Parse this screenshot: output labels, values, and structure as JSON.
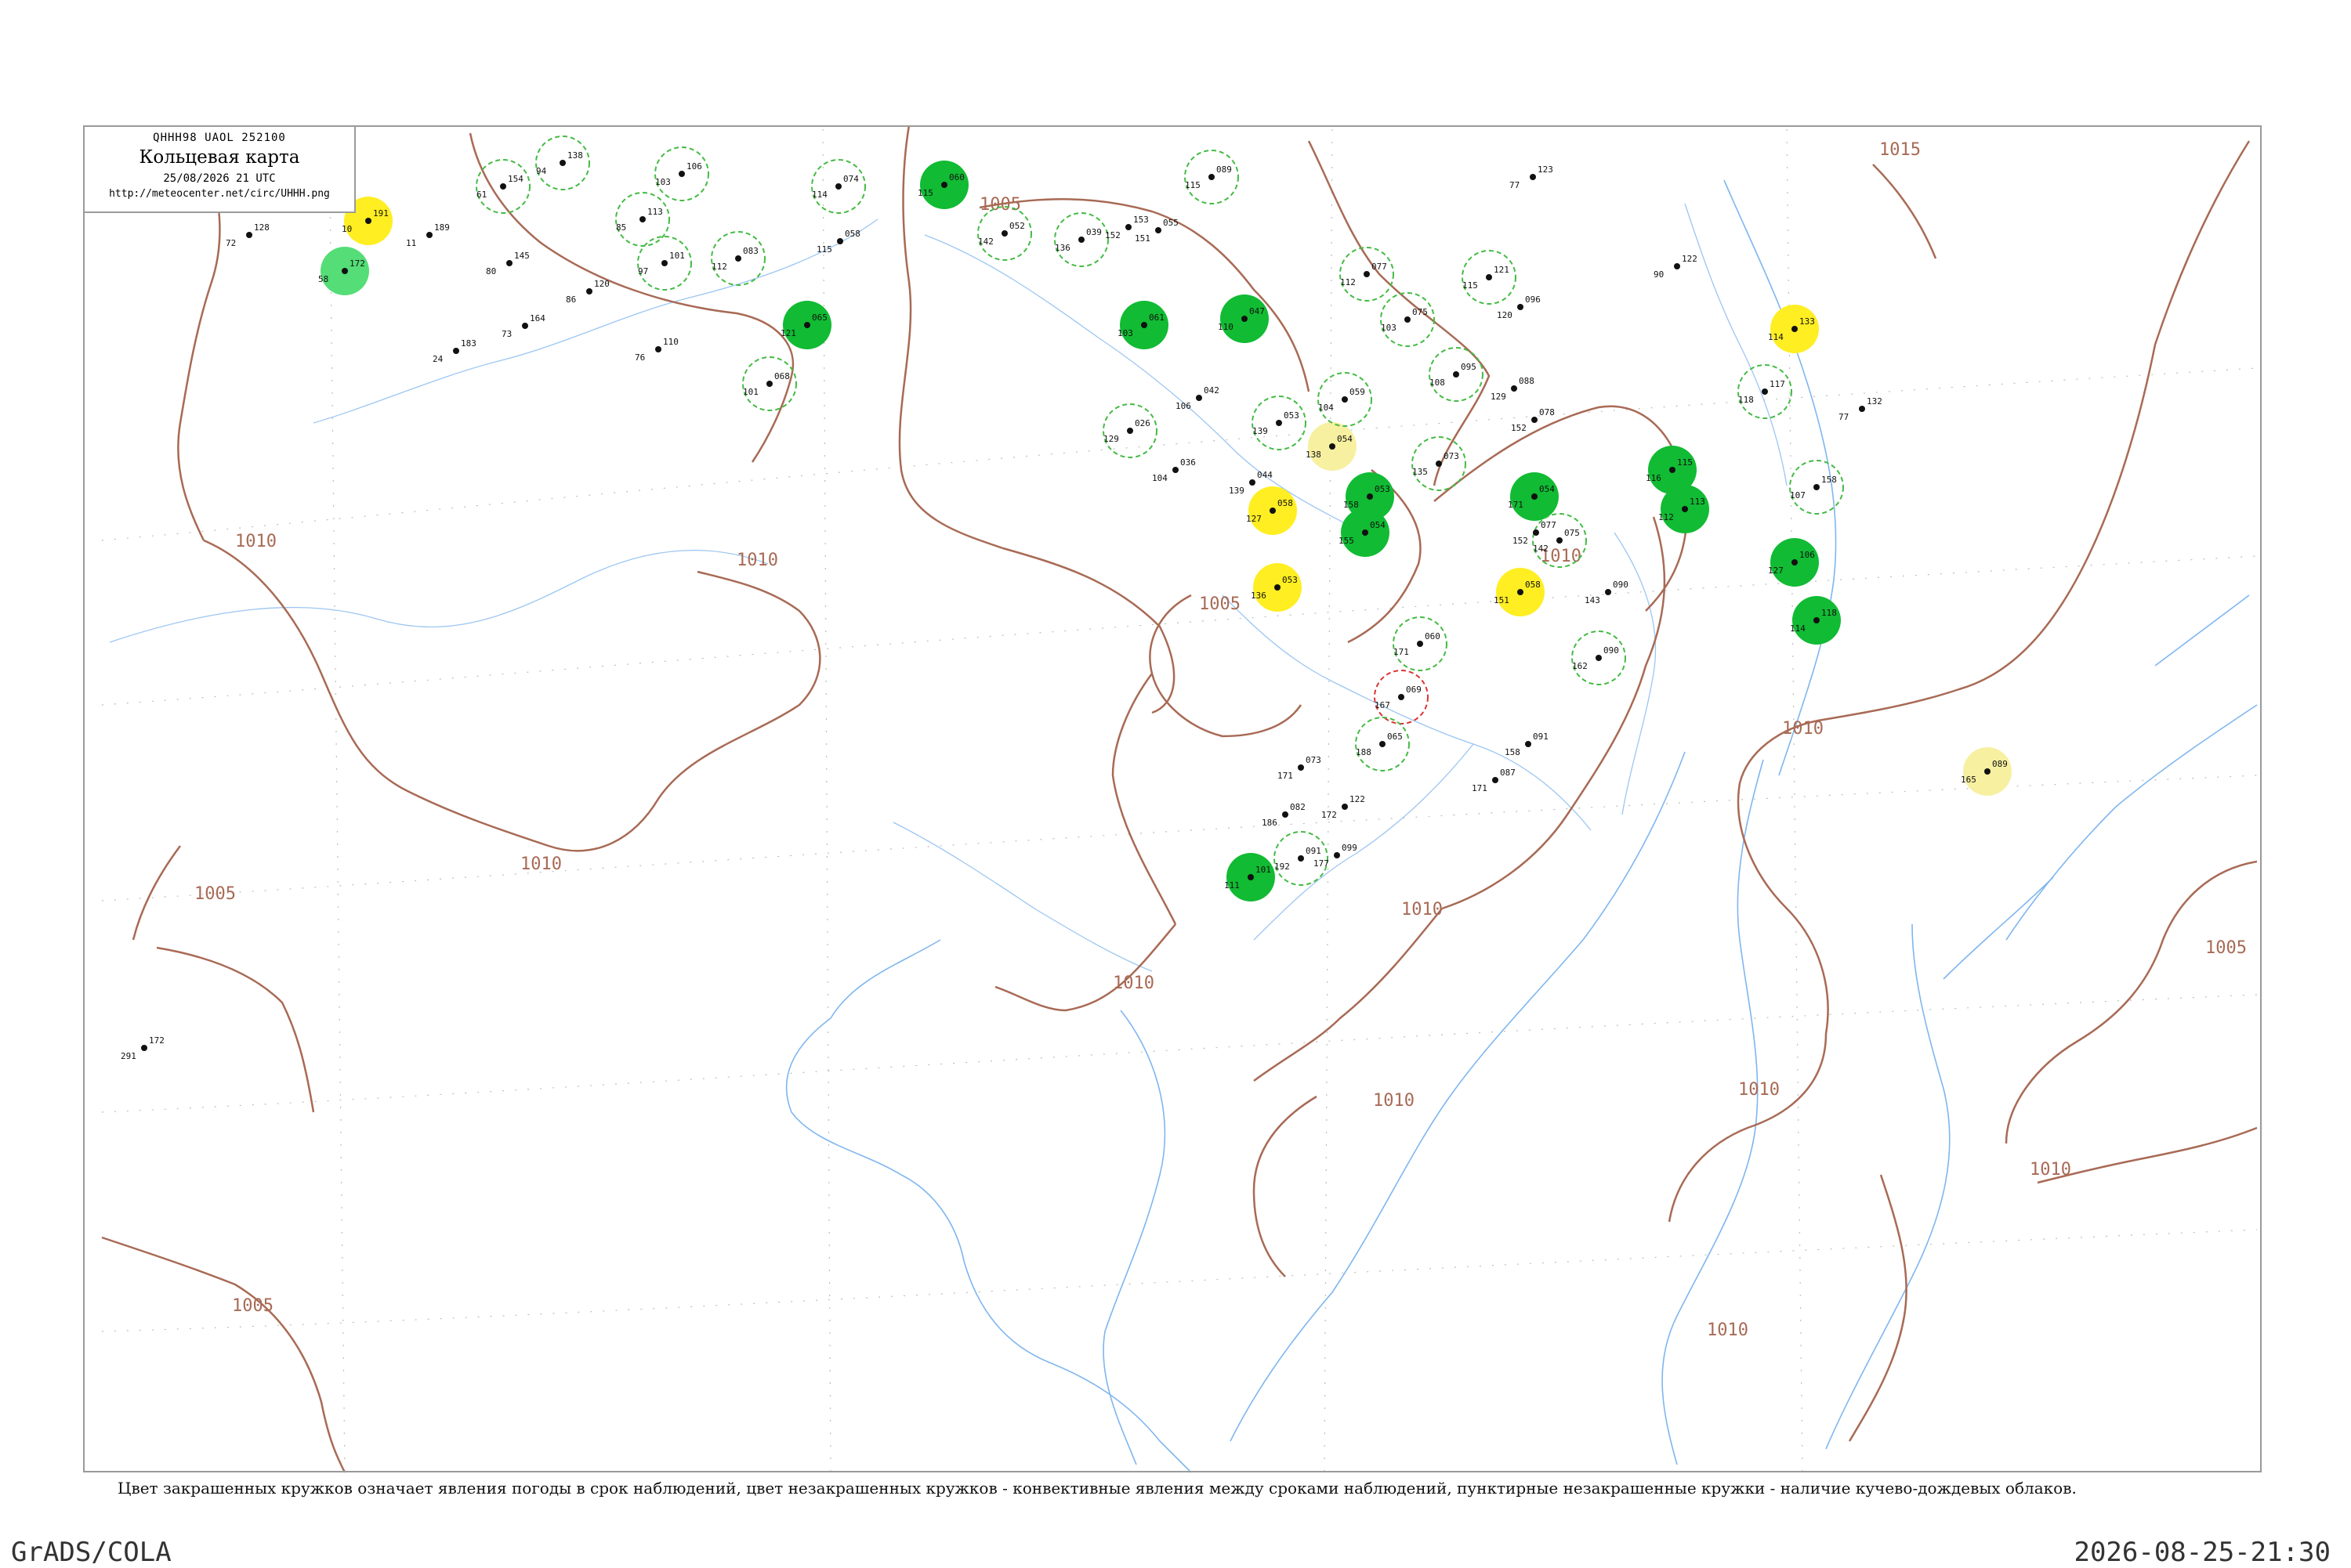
{
  "header": {
    "bulletin_code": "QHHH98  UAOL  252100",
    "title": "Кольцевая карта",
    "date": "25/08/2026 21 UTC",
    "url": "http://meteocenter.net/circ/UHHH.png"
  },
  "footer": {
    "legend_note": "Цвет закрашенных кружков означает явления погоды в срок наблюдений, цвет незакрашенных кружков - конвективные явления между сроками наблюдений, пунктирные незакрашенные кружки - наличие кучево-дождевых облаков.",
    "software": "GrADS/COLA",
    "timestamp": "2026-08-25-21:30"
  },
  "isobar_labels": [
    "1015",
    "1005",
    "1010",
    "1010",
    "1005",
    "1010",
    "1010",
    "1005",
    "1010",
    "1010",
    "1010",
    "1005",
    "1010",
    "1010",
    "1010",
    "1010",
    "1005"
  ],
  "colors": {
    "isobar": "#a86a55",
    "coast": "#7fb6ef",
    "rain_fill": "#11bb33",
    "fog_fill": "#ffee22",
    "pale_yellow_fill": "#f7f0a0",
    "shower_fill": "#55dd77",
    "cb_ring": "#44bb44",
    "thunder_ring": "#dd3333"
  },
  "stations": {
    "filled": [
      {
        "fill": "#ffee22",
        "top": "191",
        "left": "10"
      },
      {
        "fill": "#55dd77",
        "top": "172",
        "left": "58"
      },
      {
        "fill": "#11bb33",
        "top": "065",
        "left": "121"
      },
      {
        "fill": "#11bb33",
        "top": "060",
        "left": "115"
      },
      {
        "fill": "#11bb33",
        "top": "061",
        "left": "103"
      },
      {
        "fill": "#11bb33",
        "top": "047",
        "left": "110"
      },
      {
        "fill": "#f7f0a0",
        "top": "054",
        "left": "138"
      },
      {
        "fill": "#ffee22",
        "top": "058",
        "left": "127"
      },
      {
        "fill": "#11bb33",
        "top": "053",
        "left": "158"
      },
      {
        "fill": "#11bb33",
        "top": "054",
        "left": "155"
      },
      {
        "fill": "#ffee22",
        "top": "053",
        "left": "136"
      },
      {
        "fill": "#11bb33",
        "top": "054",
        "left": "171"
      },
      {
        "fill": "#ffee22",
        "top": "058",
        "left": "151"
      },
      {
        "fill": "#11bb33",
        "top": "115",
        "left": "116"
      },
      {
        "fill": "#11bb33",
        "top": "113",
        "left": "112"
      },
      {
        "fill": "#ffee22",
        "top": "133",
        "left": "114"
      },
      {
        "fill": "#11bb33",
        "top": "106",
        "left": "127"
      },
      {
        "fill": "#11bb33",
        "top": "118",
        "left": "114"
      },
      {
        "fill": "#11bb33",
        "top": "101",
        "left": "111"
      },
      {
        "fill": "#f7f0a0",
        "top": "089",
        "left": "165"
      }
    ],
    "rings": [
      {
        "ring": "#44bb44",
        "top": "154",
        "left": "61"
      },
      {
        "ring": "#44bb44",
        "top": "138",
        "left": "94"
      },
      {
        "ring": "#44bb44",
        "top": "113",
        "left": "85"
      },
      {
        "ring": "#44bb44",
        "top": "106",
        "left": "103"
      },
      {
        "ring": "#44bb44",
        "top": "101",
        "left": "97"
      },
      {
        "ring": "#44bb44",
        "top": "083",
        "left": "112"
      },
      {
        "ring": "#44bb44",
        "top": "068",
        "left": "101"
      },
      {
        "ring": "#44bb44",
        "top": "074",
        "left": "114"
      },
      {
        "ring": "#44bb44",
        "top": "052",
        "left": "142"
      },
      {
        "ring": "#44bb44",
        "top": "039",
        "left": "136"
      },
      {
        "ring": "#44bb44",
        "top": "089",
        "left": "115"
      },
      {
        "ring": "#44bb44",
        "top": "077",
        "left": "112"
      },
      {
        "ring": "#44bb44",
        "top": "075",
        "left": "103"
      },
      {
        "ring": "#44bb44",
        "top": "121",
        "left": "115"
      },
      {
        "ring": "#44bb44",
        "top": "095",
        "left": "108"
      },
      {
        "ring": "#44bb44",
        "top": "026",
        "left": "129"
      },
      {
        "ring": "#44bb44",
        "top": "053",
        "left": "139"
      },
      {
        "ring": "#44bb44",
        "top": "059",
        "left": "104"
      },
      {
        "ring": "#44bb44",
        "top": "073",
        "left": "135"
      },
      {
        "ring": "#44bb44",
        "top": "075",
        "left": "142"
      },
      {
        "ring": "#44bb44",
        "top": "060",
        "left": "171"
      },
      {
        "ring": "#dd3333",
        "top": "069",
        "left": "167"
      },
      {
        "ring": "#44bb44",
        "top": "065",
        "left": "188"
      },
      {
        "ring": "#44bb44",
        "top": "090",
        "left": "162"
      },
      {
        "ring": "#44bb44",
        "top": "091",
        "left": "192"
      },
      {
        "ring": "#44bb44",
        "top": "158",
        "left": "107"
      },
      {
        "ring": "#44bb44",
        "top": "117",
        "left": "118"
      }
    ],
    "plain": [
      {
        "top": "128",
        "left": "72"
      },
      {
        "top": "189",
        "left": "11"
      },
      {
        "top": "145",
        "left": "80"
      },
      {
        "top": "120",
        "left": "86"
      },
      {
        "top": "183",
        "left": "24"
      },
      {
        "top": "164",
        "left": "73"
      },
      {
        "top": "110",
        "left": "76"
      },
      {
        "top": "058",
        "left": "115"
      },
      {
        "top": "153",
        "left": "152"
      },
      {
        "top": "055",
        "left": "151"
      },
      {
        "top": "042",
        "left": "106"
      },
      {
        "top": "044",
        "left": "139"
      },
      {
        "top": "036",
        "left": "104"
      },
      {
        "top": "088",
        "left": "129"
      },
      {
        "top": "078",
        "left": "152"
      },
      {
        "top": "077",
        "left": "152"
      },
      {
        "top": "123",
        "left": "77"
      },
      {
        "top": "122",
        "left": "90"
      },
      {
        "top": "096",
        "left": "120"
      },
      {
        "top": "090",
        "left": "143"
      },
      {
        "top": "091",
        "left": "158"
      },
      {
        "top": "087",
        "left": "171"
      },
      {
        "top": "073",
        "left": "171"
      },
      {
        "top": "082",
        "left": "186"
      },
      {
        "top": "122",
        "left": "172"
      },
      {
        "top": "099",
        "left": "177"
      },
      {
        "top": "132",
        "left": "77"
      },
      {
        "top": "172",
        "left": "291"
      }
    ]
  }
}
